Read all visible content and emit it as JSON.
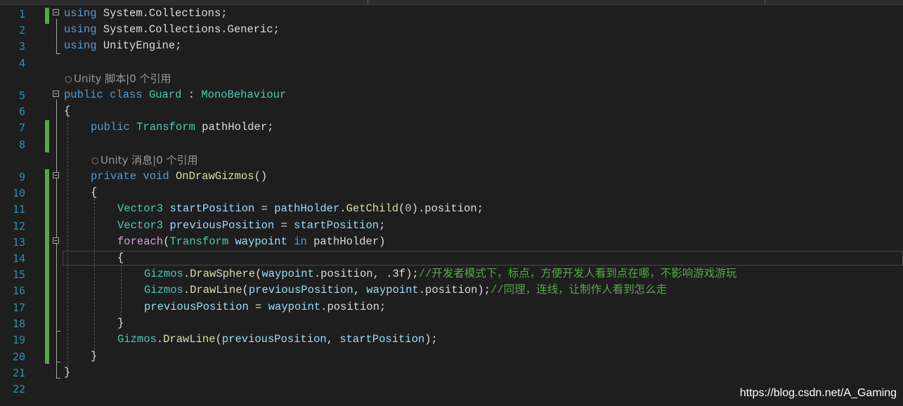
{
  "editor": {
    "language": "csharp",
    "lines": [
      {
        "number": "1"
      },
      {
        "number": "2"
      },
      {
        "number": "3"
      },
      {
        "number": "4"
      },
      {
        "number": "5"
      },
      {
        "number": "6"
      },
      {
        "number": "7"
      },
      {
        "number": "8"
      },
      {
        "number": "9"
      },
      {
        "number": "10"
      },
      {
        "number": "11"
      },
      {
        "number": "12"
      },
      {
        "number": "13"
      },
      {
        "number": "14"
      },
      {
        "number": "15"
      },
      {
        "number": "16"
      },
      {
        "number": "17"
      },
      {
        "number": "18"
      },
      {
        "number": "19"
      },
      {
        "number": "20"
      },
      {
        "number": "21"
      },
      {
        "number": "22"
      }
    ],
    "code": {
      "l1": {
        "kw": "using",
        "rest": " System.Collections;"
      },
      "l2": {
        "kw": "using",
        "rest": " System.Collections.Generic;"
      },
      "l3": {
        "kw": "using",
        "rest": " UnityEngine;"
      },
      "l5": {
        "kw1": "public",
        "kw2": "class",
        "name": "Guard",
        "colon": " : ",
        "base": "MonoBehaviour"
      },
      "l6": {
        "text": "{"
      },
      "l7": {
        "kw": "public",
        "type": "Transform",
        "rest": " pathHolder;"
      },
      "l9": {
        "kw1": "private",
        "kw2": "void",
        "method": "OnDrawGizmos",
        "rest": "()"
      },
      "l10": {
        "text": "{"
      },
      "l11": {
        "type": "Vector3",
        "var": "startPosition",
        "eq": " = ",
        "obj": "pathHolder",
        "dot": ".",
        "method": "GetChild",
        "open": "(",
        "num": "0",
        "close": ").position;"
      },
      "l12": {
        "type": "Vector3",
        "var": "previousPosition",
        "eq": " = ",
        "var2": "startPosition",
        "end": ";"
      },
      "l13": {
        "kw": "foreach",
        "open": "(",
        "type": "Transform",
        "var": "waypoint",
        "in": "in",
        "rest": " pathHolder)"
      },
      "l14": {
        "text": "{"
      },
      "l15": {
        "type": "Gizmos",
        "dot": ".",
        "method": "DrawSphere",
        "open": "(",
        "var": "waypoint",
        "rest": ".position, .3f);",
        "comment": "//开发者模式下，标点，方便开发人看到点在哪，不影响游戏游玩"
      },
      "l16": {
        "type": "Gizmos",
        "dot": ".",
        "method": "DrawLine",
        "open": "(",
        "var": "previousPosition",
        "sep": ", ",
        "var2": "waypoint",
        "rest": ".position);",
        "comment": "//同理，连线，让制作人看到怎么走"
      },
      "l17": {
        "var": "previousPosition",
        "eq": " = ",
        "var2": "waypoint",
        "rest": ".position;"
      },
      "l18": {
        "text": "}"
      },
      "l19": {
        "type": "Gizmos",
        "dot": ".",
        "method": "DrawLine",
        "open": "(",
        "var": "previousPosition",
        "sep": ", ",
        "var2": "startPosition",
        "rest": ");"
      },
      "l20": {
        "text": "}"
      },
      "l21": {
        "text": "}"
      }
    },
    "codelens": {
      "class_hint": "Unity 脚本|0 个引用",
      "method_hint": "Unity 消息|0 个引用"
    }
  },
  "watermark": "https://blog.csdn.net/A_Gaming",
  "colors": {
    "background": "#1e1e1e",
    "line_number": "#2b91af",
    "keyword": "#569cd6",
    "control_keyword": "#d8a0df",
    "type": "#4ec9b0",
    "variable": "#9cdcfe",
    "method": "#dcdcaa",
    "comment": "#57a64a",
    "number": "#b5cea8",
    "change_marker": "#57a64a"
  }
}
